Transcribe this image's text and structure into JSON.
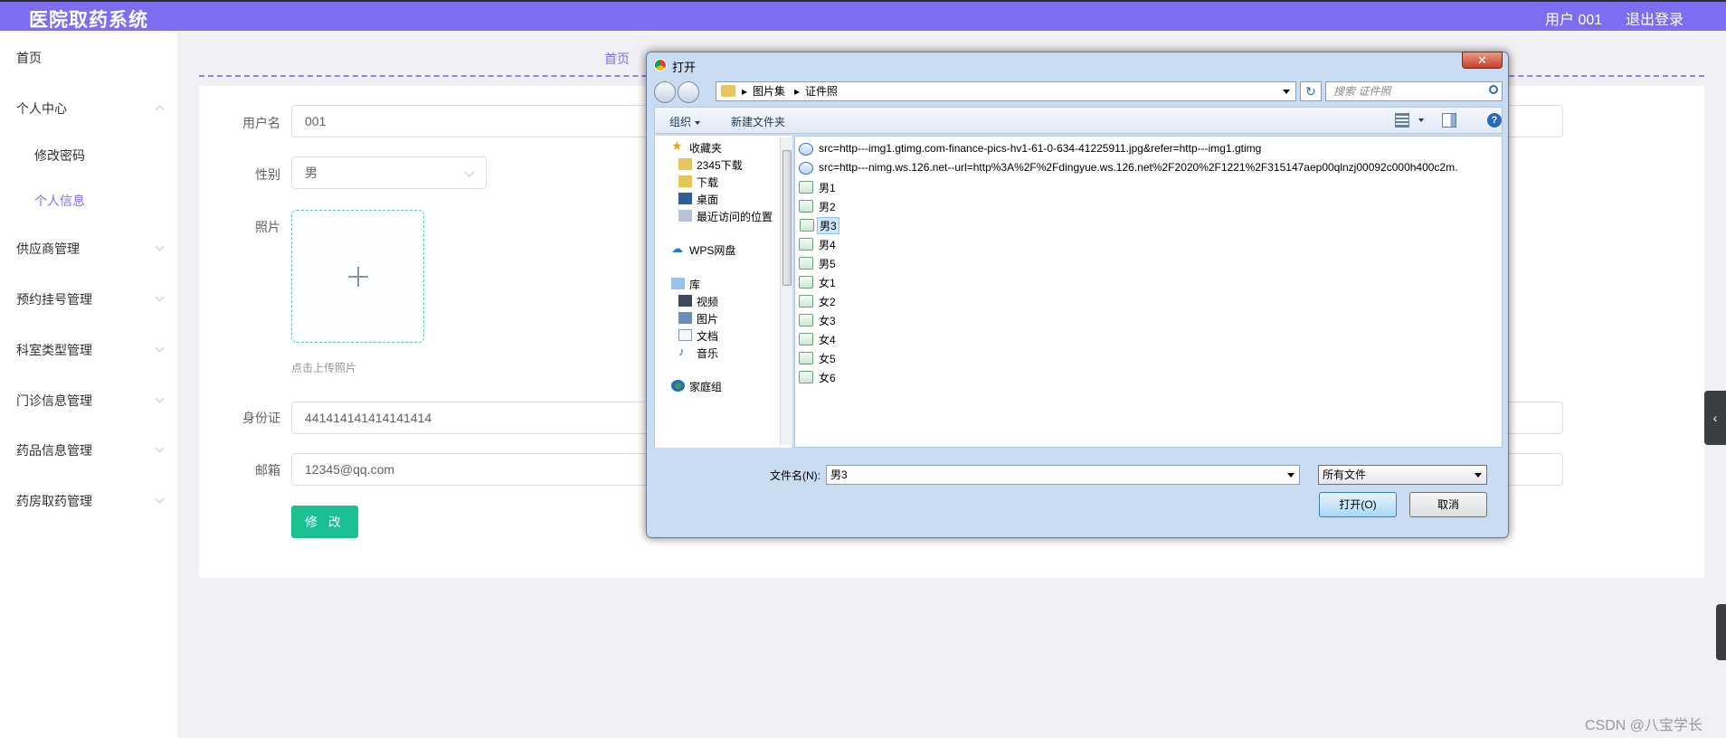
{
  "header": {
    "title": "医院取药系统",
    "user": "用户 001",
    "logout": "退出登录"
  },
  "sidebar": {
    "items": [
      {
        "label": "首页"
      },
      {
        "label": "个人中心"
      },
      {
        "label": "修改密码"
      },
      {
        "label": "个人信息"
      },
      {
        "label": "供应商管理"
      },
      {
        "label": "预约挂号管理"
      },
      {
        "label": "科室类型管理"
      },
      {
        "label": "门诊信息管理"
      },
      {
        "label": "药品信息管理"
      },
      {
        "label": "药房取药管理"
      }
    ]
  },
  "breadcrumb": "首页",
  "form": {
    "username_label": "用户名",
    "username_value": "001",
    "gender_label": "性别",
    "gender_value": "男",
    "photo_label": "照片",
    "photo_hint": "点击上传照片",
    "id_label": "身份证",
    "id_value": "441414141414141414",
    "email_label": "邮箱",
    "email_value": "12345@qq.com",
    "submit": "修 改"
  },
  "dialog": {
    "title": "打开",
    "close": "✕",
    "address": [
      "图片集",
      "证件照"
    ],
    "search_placeholder": "搜索 证件照",
    "toolbar": {
      "organize": "组织",
      "new_folder": "新建文件夹"
    },
    "nav": {
      "favorites": "收藏夹",
      "fav_items": [
        "2345下载",
        "下载",
        "桌面",
        "最近访问的位置"
      ],
      "wps": "WPS网盘",
      "library": "库",
      "lib_items": [
        "视频",
        "图片",
        "文档",
        "音乐"
      ],
      "homegroup": "家庭组"
    },
    "files": [
      "src=http---img1.gtimg.com-finance-pics-hv1-61-0-634-41225911.jpg&refer=http---img1.gtimg",
      "src=http---nimg.ws.126.net--url=http%3A%2F%2Fdingyue.ws.126.net%2F2020%2F1221%2F315147aep00qlnzj00092c000h400c2m.",
      "男1",
      "男2",
      "男3",
      "男4",
      "男5",
      "女1",
      "女2",
      "女3",
      "女4",
      "女5",
      "女6"
    ],
    "selected_file": "男3",
    "filename_label": "文件名(N):",
    "filename_value": "男3",
    "filetype": "所有文件",
    "open_button": "打开(O)",
    "cancel_button": "取消"
  },
  "watermark": "CSDN @八宝学长",
  "side_tab": "‹"
}
